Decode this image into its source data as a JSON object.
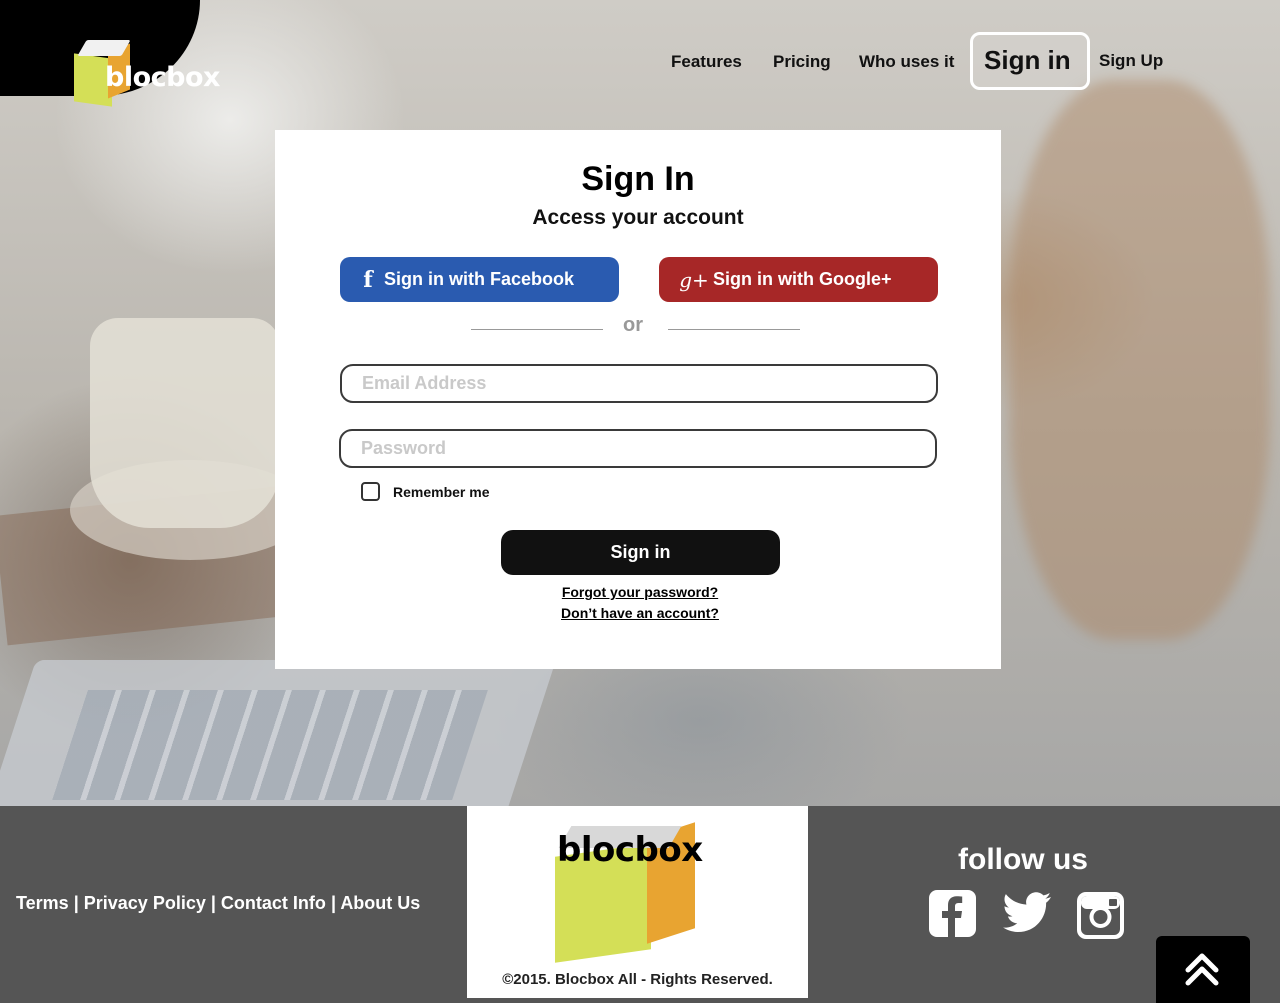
{
  "header": {
    "logo_text": "blocbox",
    "nav": [
      {
        "label": "Features"
      },
      {
        "label": "Pricing"
      },
      {
        "label": "Who uses it"
      },
      {
        "label": "Sign in"
      },
      {
        "label": "Sign Up"
      }
    ]
  },
  "card": {
    "title": "Sign In",
    "subtitle": "Access your account",
    "facebook_button": "Sign in with Facebook",
    "google_button": "Sign in with Google+",
    "divider_text": "or",
    "email_placeholder": "Email Address",
    "password_placeholder": "Password",
    "remember_label": "Remember me",
    "submit_label": "Sign in",
    "forgot_link": "Forgot your password?",
    "signup_link": "Don’t have an account?"
  },
  "footer": {
    "links": [
      "Terms",
      "Privacy Policy",
      "Contact Info",
      "About Us"
    ],
    "brand": "blocbox",
    "copyright": "©2015. Blocbox All - Rights Reserved.",
    "follow_label": "follow us",
    "social_icons": [
      "facebook-icon",
      "twitter-icon",
      "instagram-icon"
    ]
  },
  "colors": {
    "facebook": "#2a5bb0",
    "google": "#a72727",
    "logo_green": "#d4df57",
    "logo_orange": "#e8a431",
    "footer_bg": "#555555"
  }
}
